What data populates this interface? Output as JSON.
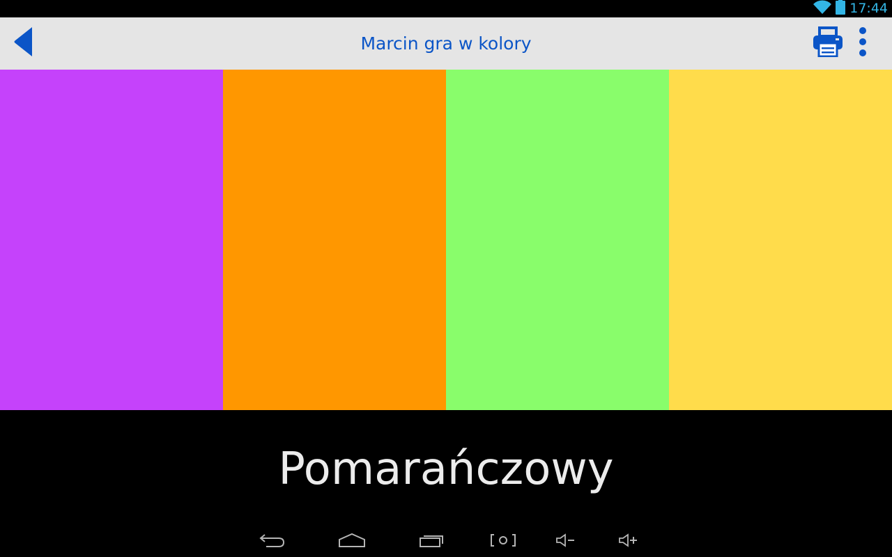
{
  "status_bar": {
    "time": "17:44",
    "wifi_icon": "wifi-icon",
    "battery_icon": "battery-icon"
  },
  "action_bar": {
    "title": "Marcin gra w kolory",
    "back_icon": "back-arrow-icon",
    "print_icon": "printer-icon",
    "overflow_icon": "overflow-menu-icon",
    "accent_color": "#0b55c7"
  },
  "swatches": [
    {
      "color": "#c542fb"
    },
    {
      "color": "#ff9700"
    },
    {
      "color": "#89fd6b"
    },
    {
      "color": "#ffdc4b"
    }
  ],
  "current_color_name": "Pomarańczowy",
  "navigation_bar": {
    "buttons": [
      "back-icon",
      "home-icon",
      "recent-apps-icon",
      "screenshot-icon",
      "volume-down-icon",
      "volume-up-icon"
    ]
  }
}
